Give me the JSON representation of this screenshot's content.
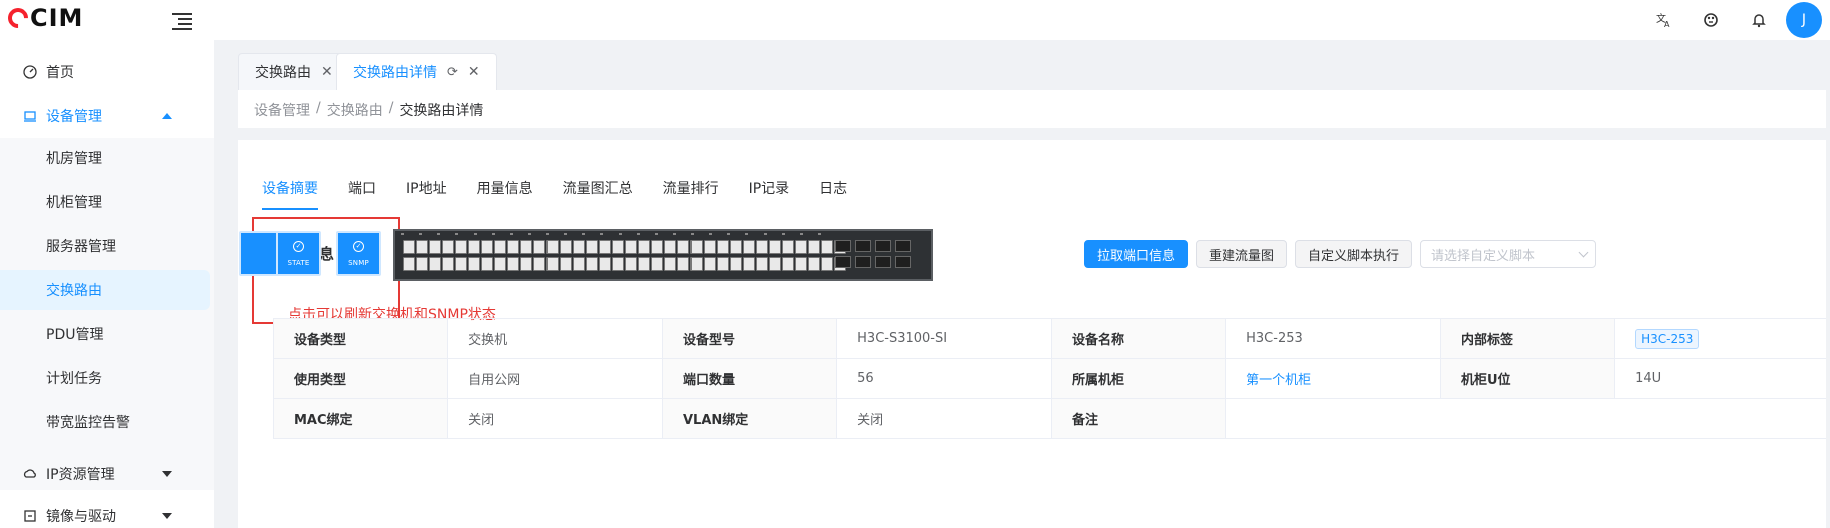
{
  "header": {
    "logo_text": "CIM",
    "icons": [
      "translate-icon",
      "theme-icon",
      "bell-icon"
    ],
    "avatar_letter": "J"
  },
  "sidebar": {
    "items": [
      {
        "label": "首页",
        "icon": "dashboard-icon"
      },
      {
        "label": "设备管理",
        "icon": "laptop-icon",
        "expanded": true
      },
      {
        "label": "IP资源管理",
        "icon": "cloud-icon"
      },
      {
        "label": "镜像与驱动",
        "icon": "disc-icon"
      }
    ],
    "sub_items": [
      "机房管理",
      "机柜管理",
      "服务器管理",
      "交换路由",
      "PDU管理",
      "计划任务",
      "带宽监控告警"
    ],
    "selected_sub": "交换路由"
  },
  "tags": [
    {
      "label": "交换路由",
      "active": false
    },
    {
      "label": "交换路由详情",
      "active": true
    }
  ],
  "breadcrumb": [
    "设备管理",
    "交换路由",
    "交换路由详情"
  ],
  "tabs": [
    "设备摘要",
    "端口",
    "IP地址",
    "用量信息",
    "流量图汇总",
    "流量排行",
    "IP记录",
    "日志"
  ],
  "active_tab": "设备摘要",
  "hardware": {
    "title": "硬件信息",
    "state_label": "STATE",
    "snmp_label": "SNMP",
    "annotation": "点击可以刷新交换机和SNMP状态"
  },
  "actions": {
    "fetch_ports": "拉取端口信息",
    "rebuild_graph": "重建流量图",
    "custom_script": "自定义脚本执行",
    "script_placeholder": "请选择自定义脚本"
  },
  "details": {
    "rows": [
      [
        {
          "k": "设备类型",
          "v": "交换机"
        },
        {
          "k": "设备型号",
          "v": "H3C-S3100-SI"
        },
        {
          "k": "设备名称",
          "v": "H3C-253"
        },
        {
          "k": "内部标签",
          "v": "H3C-253"
        }
      ],
      [
        {
          "k": "使用类型",
          "v": "自用公网"
        },
        {
          "k": "端口数量",
          "v": "56"
        },
        {
          "k": "所属机柜",
          "v": "第一个机柜"
        },
        {
          "k": "机柜U位",
          "v": "14U"
        }
      ],
      [
        {
          "k": "MAC绑定",
          "v": "关闭"
        },
        {
          "k": "VLAN绑定",
          "v": "关闭"
        },
        {
          "k": "备注",
          "v": ""
        }
      ]
    ]
  },
  "colors": {
    "accent": "#1890ff",
    "annotation": "#e53935"
  }
}
